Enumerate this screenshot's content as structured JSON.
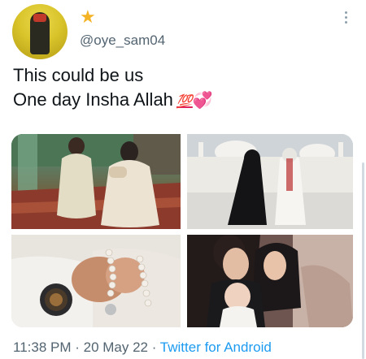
{
  "tweet": {
    "handle": "@oye_sam04",
    "badge_icon": "star-icon",
    "text_line1": "This could be us",
    "text_line2": "One day Insha Allah",
    "emoji_100": "💯",
    "emoji_hearts": "💞",
    "timestamp": "11:38 PM · 20 May 22 · ",
    "source": "Twitter for Android"
  },
  "colors": {
    "star": "#f3b325",
    "link": "#1d9bf0",
    "muted": "#536471"
  }
}
